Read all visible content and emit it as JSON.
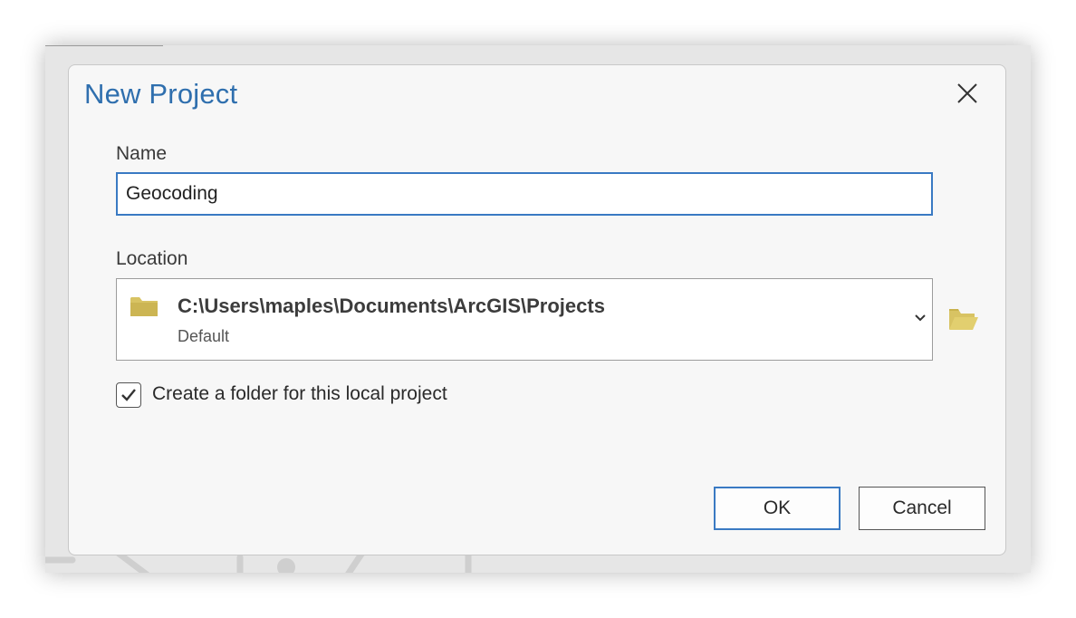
{
  "dialog": {
    "title": "New Project",
    "close_icon": "close-icon"
  },
  "name": {
    "label": "Name",
    "value": "Geocoding"
  },
  "location": {
    "label": "Location",
    "path": "C:\\Users\\maples\\Documents\\ArcGIS\\Projects",
    "subtitle": "Default",
    "icon": "folder-icon",
    "dropdown_icon": "chevron-down-icon",
    "browse_icon": "open-folder-icon"
  },
  "create_folder": {
    "label": "Create a folder for this local project",
    "checked": true
  },
  "buttons": {
    "ok": "OK",
    "cancel": "Cancel"
  },
  "colors": {
    "accent": "#2f6fae",
    "focus_border": "#3a7ac3",
    "folder": "#d6c15f"
  }
}
